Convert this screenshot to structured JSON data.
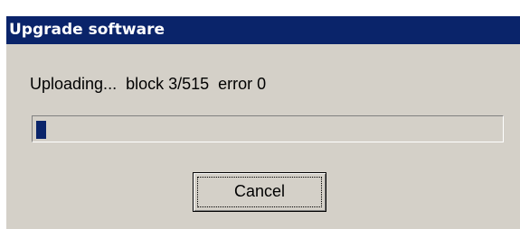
{
  "window": {
    "title": "Upgrade software"
  },
  "status": {
    "text": "Uploading...  block 3/515  error 0"
  },
  "progress": {
    "current_block": 3,
    "total_blocks": 515,
    "fill_color": "#0a246a"
  },
  "buttons": {
    "cancel_label": "Cancel"
  },
  "colors": {
    "title_bar": "#0a246a",
    "dialog_face": "#d4d0c8"
  }
}
